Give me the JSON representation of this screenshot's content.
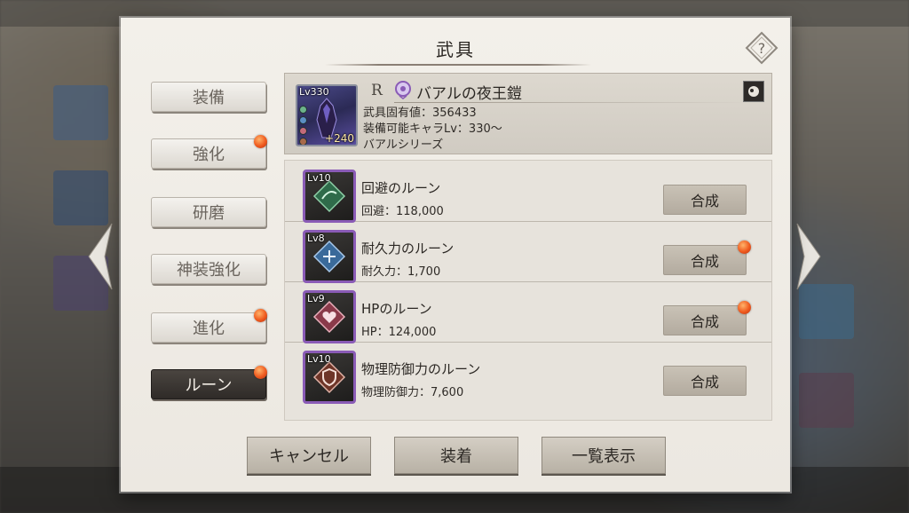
{
  "dialog": {
    "title": "武具"
  },
  "tabs": [
    {
      "label": "装備",
      "active": false,
      "badge": false
    },
    {
      "label": "強化",
      "active": false,
      "badge": true
    },
    {
      "label": "研磨",
      "active": false,
      "badge": false
    },
    {
      "label": "神装強化",
      "active": false,
      "badge": false
    },
    {
      "label": "進化",
      "active": false,
      "badge": true
    },
    {
      "label": "ルーン",
      "active": true,
      "badge": true
    }
  ],
  "equipment": {
    "level": "Lv330",
    "plus": "+240",
    "rarity": "R",
    "name": "バアルの夜王鎧",
    "stats": [
      "武具固有値：356433",
      "装備可能キャラLv：330〜",
      "バアルシリーズ"
    ]
  },
  "runes": [
    {
      "level": "Lv10",
      "name": "回避のルーン",
      "stat": "回避：118,000",
      "button": "合成",
      "badge": false,
      "color": "#3f8a5a"
    },
    {
      "level": "Lv8",
      "name": "耐久力のルーン",
      "stat": "耐久力：1,700",
      "button": "合成",
      "badge": true,
      "color": "#4b7fb0"
    },
    {
      "level": "Lv9",
      "name": "HPのルーン",
      "stat": "HP：124,000",
      "button": "合成",
      "badge": true,
      "color": "#b04b60"
    },
    {
      "level": "Lv10",
      "name": "物理防御力のルーン",
      "stat": "物理防御力：7,600",
      "button": "合成",
      "badge": false,
      "color": "#8a4a3a"
    }
  ],
  "buttons": {
    "cancel": "キャンセル",
    "equip": "装着",
    "list": "一覧表示"
  },
  "colors": {
    "accent_badge": "#ef5a1e",
    "rune_frame": "#8a5bb6"
  }
}
